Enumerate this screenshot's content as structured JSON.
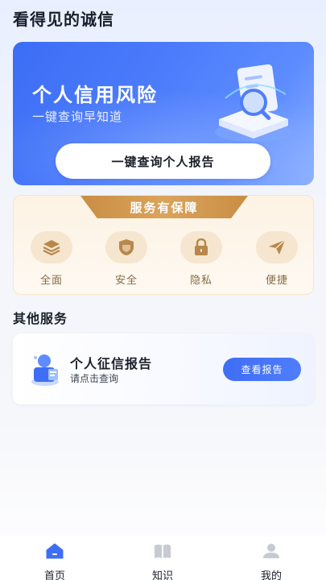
{
  "app": {
    "title": "看得见的诚信"
  },
  "hero": {
    "title": "个人信用风险",
    "subtitle": "一键查询早知道",
    "button_label": "一键查询个人报告"
  },
  "guarantee": {
    "banner": "服务有保障",
    "items": [
      {
        "label": "全面",
        "icon": "layers-icon"
      },
      {
        "label": "安全",
        "icon": "shield-icon"
      },
      {
        "label": "隐私",
        "icon": "lock-icon"
      },
      {
        "label": "便捷",
        "icon": "send-icon"
      }
    ]
  },
  "other_services": {
    "title": "其他服务",
    "card": {
      "title": "个人征信报告",
      "subtitle": "请点击查询",
      "button_label": "查看报告",
      "icon": "user-report-icon"
    }
  },
  "tabbar": {
    "items": [
      {
        "label": "首页",
        "icon": "home-icon",
        "active": true
      },
      {
        "label": "知识",
        "icon": "book-icon",
        "active": false
      },
      {
        "label": "我的",
        "icon": "person-icon",
        "active": false
      }
    ]
  },
  "colors": {
    "accent": "#3f6ef6",
    "gold": "#c98e45",
    "gold_icon": "#b8874b"
  }
}
